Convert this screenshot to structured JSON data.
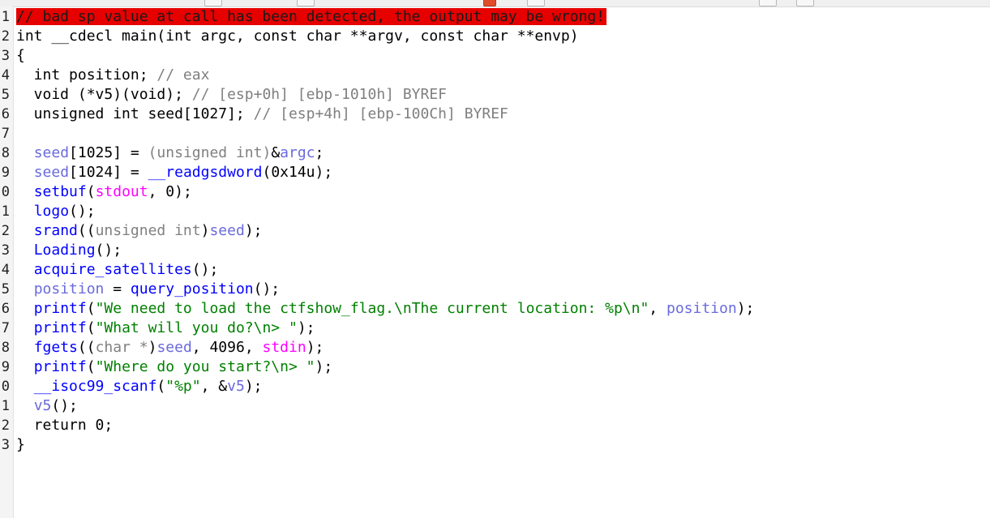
{
  "gutter": {
    "line_numbers": [
      "1",
      "2",
      "3",
      "4",
      "5",
      "6",
      "7",
      "8",
      "9",
      "0",
      "1",
      "2",
      "3",
      "4",
      "5",
      "6",
      "7",
      "8",
      "9",
      "0",
      "1",
      "2",
      "3"
    ]
  },
  "code": {
    "lines": [
      [
        {
          "t": "// bad sp value at call has been detected, the output may be wrong!",
          "c": "error"
        }
      ],
      [
        {
          "t": "int __cdecl main(int argc, const char **argv, const char **envp)",
          "c": "plain"
        }
      ],
      [
        {
          "t": "{",
          "c": "plain"
        }
      ],
      [
        {
          "t": "  int position; ",
          "c": "plain"
        },
        {
          "t": "// eax",
          "c": "comment"
        }
      ],
      [
        {
          "t": "  void (*v5)(void); ",
          "c": "plain"
        },
        {
          "t": "// [esp+0h] [ebp-1010h] BYREF",
          "c": "comment"
        }
      ],
      [
        {
          "t": "  unsigned int seed[1027]; ",
          "c": "plain"
        },
        {
          "t": "// [esp+4h] [ebp-100Ch] BYREF",
          "c": "comment"
        }
      ],
      [],
      [
        {
          "t": "  ",
          "c": "plain"
        },
        {
          "t": "seed",
          "c": "var"
        },
        {
          "t": "[1025] = ",
          "c": "plain"
        },
        {
          "t": "(unsigned int)",
          "c": "gray"
        },
        {
          "t": "&",
          "c": "plain"
        },
        {
          "t": "argc",
          "c": "var"
        },
        {
          "t": ";",
          "c": "plain"
        }
      ],
      [
        {
          "t": "  ",
          "c": "plain"
        },
        {
          "t": "seed",
          "c": "var"
        },
        {
          "t": "[1024] = ",
          "c": "plain"
        },
        {
          "t": "__readgsdword",
          "c": "blue"
        },
        {
          "t": "(0x14u);",
          "c": "plain"
        }
      ],
      [
        {
          "t": "  ",
          "c": "plain"
        },
        {
          "t": "setbuf",
          "c": "blue"
        },
        {
          "t": "(",
          "c": "plain"
        },
        {
          "t": "stdout",
          "c": "pink"
        },
        {
          "t": ", 0);",
          "c": "plain"
        }
      ],
      [
        {
          "t": "  ",
          "c": "plain"
        },
        {
          "t": "logo",
          "c": "blue"
        },
        {
          "t": "();",
          "c": "plain"
        }
      ],
      [
        {
          "t": "  ",
          "c": "plain"
        },
        {
          "t": "srand",
          "c": "blue"
        },
        {
          "t": "((",
          "c": "plain"
        },
        {
          "t": "unsigned int",
          "c": "gray"
        },
        {
          "t": ")",
          "c": "plain"
        },
        {
          "t": "seed",
          "c": "var"
        },
        {
          "t": ");",
          "c": "plain"
        }
      ],
      [
        {
          "t": "  ",
          "c": "plain"
        },
        {
          "t": "Loading",
          "c": "blue"
        },
        {
          "t": "();",
          "c": "plain"
        }
      ],
      [
        {
          "t": "  ",
          "c": "plain"
        },
        {
          "t": "acquire_satellites",
          "c": "blue"
        },
        {
          "t": "();",
          "c": "plain"
        }
      ],
      [
        {
          "t": "  ",
          "c": "plain"
        },
        {
          "t": "position",
          "c": "var"
        },
        {
          "t": " = ",
          "c": "plain"
        },
        {
          "t": "query_position",
          "c": "blue"
        },
        {
          "t": "();",
          "c": "plain"
        }
      ],
      [
        {
          "t": "  ",
          "c": "plain"
        },
        {
          "t": "printf",
          "c": "blue"
        },
        {
          "t": "(",
          "c": "plain"
        },
        {
          "t": "\"We need to load the ctfshow_flag.\\nThe current location: %p\\n\"",
          "c": "green"
        },
        {
          "t": ", ",
          "c": "plain"
        },
        {
          "t": "position",
          "c": "var"
        },
        {
          "t": ");",
          "c": "plain"
        }
      ],
      [
        {
          "t": "  ",
          "c": "plain"
        },
        {
          "t": "printf",
          "c": "blue"
        },
        {
          "t": "(",
          "c": "plain"
        },
        {
          "t": "\"What will you do?\\n> \"",
          "c": "green"
        },
        {
          "t": ");",
          "c": "plain"
        }
      ],
      [
        {
          "t": "  ",
          "c": "plain"
        },
        {
          "t": "fgets",
          "c": "blue"
        },
        {
          "t": "((",
          "c": "plain"
        },
        {
          "t": "char *",
          "c": "gray"
        },
        {
          "t": ")",
          "c": "plain"
        },
        {
          "t": "seed",
          "c": "var"
        },
        {
          "t": ", 4096, ",
          "c": "plain"
        },
        {
          "t": "stdin",
          "c": "pink"
        },
        {
          "t": ");",
          "c": "plain"
        }
      ],
      [
        {
          "t": "  ",
          "c": "plain"
        },
        {
          "t": "printf",
          "c": "blue"
        },
        {
          "t": "(",
          "c": "plain"
        },
        {
          "t": "\"Where do you start?\\n> \"",
          "c": "green"
        },
        {
          "t": ");",
          "c": "plain"
        }
      ],
      [
        {
          "t": "  ",
          "c": "plain"
        },
        {
          "t": "__isoc99_scanf",
          "c": "blue"
        },
        {
          "t": "(",
          "c": "plain"
        },
        {
          "t": "\"%p\"",
          "c": "green"
        },
        {
          "t": ", &",
          "c": "plain"
        },
        {
          "t": "v5",
          "c": "var"
        },
        {
          "t": ");",
          "c": "plain"
        }
      ],
      [
        {
          "t": "  ",
          "c": "plain"
        },
        {
          "t": "v5",
          "c": "var"
        },
        {
          "t": "();",
          "c": "plain"
        }
      ],
      [
        {
          "t": "  return 0;",
          "c": "plain"
        }
      ],
      [
        {
          "t": "}",
          "c": "plain"
        }
      ]
    ]
  }
}
